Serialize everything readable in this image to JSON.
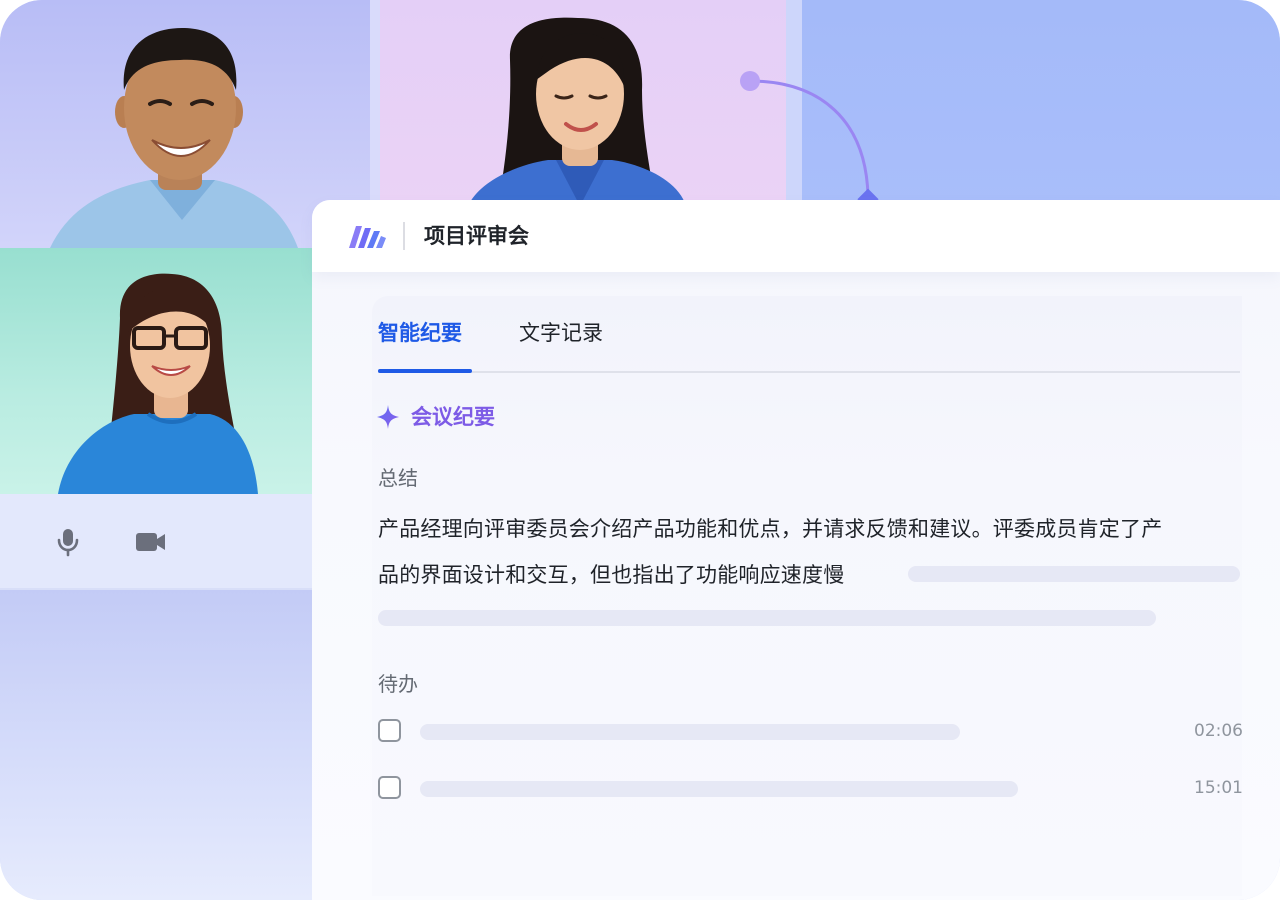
{
  "meeting": {
    "title": "项目评审会"
  },
  "tabs": [
    {
      "label": "智能纪要",
      "active": true
    },
    {
      "label": "文字记录",
      "active": false
    }
  ],
  "minutes": {
    "heading": "会议纪要",
    "summary_label": "总结",
    "summary_lines": [
      "产品经理向评审委员会介绍产品功能和优点，并请求反馈和建议。评委成员肯定了产",
      "品的界面设计和交互，但也指出了功能响应速度慢"
    ],
    "todo_label": "待办",
    "todos": [
      {
        "time": "02:06",
        "checked": false
      },
      {
        "time": "15:01",
        "checked": false
      }
    ]
  },
  "controls": {
    "mic_icon": "microphone-icon",
    "camera_icon": "video-camera-icon"
  },
  "colors": {
    "accent": "#1f5ae6",
    "minutes_heading": "#7d5be6",
    "logo": "#6f6cf5",
    "connector": "#9a86f2",
    "connector_end": "#6a73f0"
  }
}
